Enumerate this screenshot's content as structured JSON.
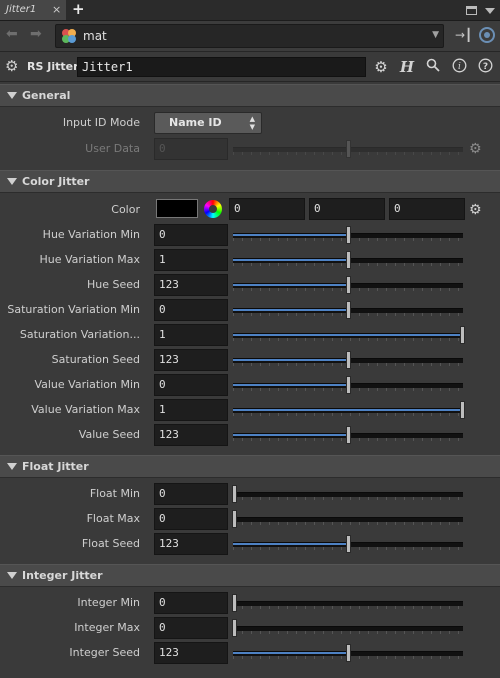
{
  "tab": {
    "title": "Jitter1",
    "close": "×",
    "add": "+"
  },
  "path": {
    "network": "mat"
  },
  "node": {
    "type_label": "RS Jitter",
    "name": "Jitter1"
  },
  "sections": {
    "general": "General",
    "color_jitter": "Color Jitter",
    "float_jitter": "Float Jitter",
    "integer_jitter": "Integer Jitter"
  },
  "general": {
    "input_id_mode_label": "Input ID Mode",
    "input_id_mode_value": "Name ID",
    "user_data_label": "User Data",
    "user_data_value": "0"
  },
  "color": {
    "label": "Color",
    "swatch": "#000000",
    "values": [
      "0",
      "0",
      "0"
    ]
  },
  "params": [
    {
      "label": "Hue Variation Min",
      "value": "0",
      "slider": 0.5
    },
    {
      "label": "Hue Variation Max",
      "value": "1",
      "slider": 0.5
    },
    {
      "label": "Hue Seed",
      "value": "123",
      "slider": 0.5
    },
    {
      "label": "Saturation Variation Min",
      "value": "0",
      "slider": 0.5
    },
    {
      "label": "Saturation Variation...",
      "value": "1",
      "slider": 1.0
    },
    {
      "label": "Saturation Seed",
      "value": "123",
      "slider": 0.5
    },
    {
      "label": "Value Variation Min",
      "value": "0",
      "slider": 0.5
    },
    {
      "label": "Value Variation Max",
      "value": "1",
      "slider": 1.0
    },
    {
      "label": "Value Seed",
      "value": "123",
      "slider": 0.5
    }
  ],
  "float": [
    {
      "label": "Float Min",
      "value": "0",
      "slider": 0.0
    },
    {
      "label": "Float Max",
      "value": "0",
      "slider": 0.0
    },
    {
      "label": "Float Seed",
      "value": "123",
      "slider": 0.5
    }
  ],
  "integer": [
    {
      "label": "Integer Min",
      "value": "0",
      "slider": 0.0
    },
    {
      "label": "Integer Max",
      "value": "0",
      "slider": 0.0
    },
    {
      "label": "Integer Seed",
      "value": "123",
      "slider": 0.5
    }
  ],
  "colors": {
    "slider_fill": "#4e82c4",
    "accent_target": "#6b8fb5"
  }
}
